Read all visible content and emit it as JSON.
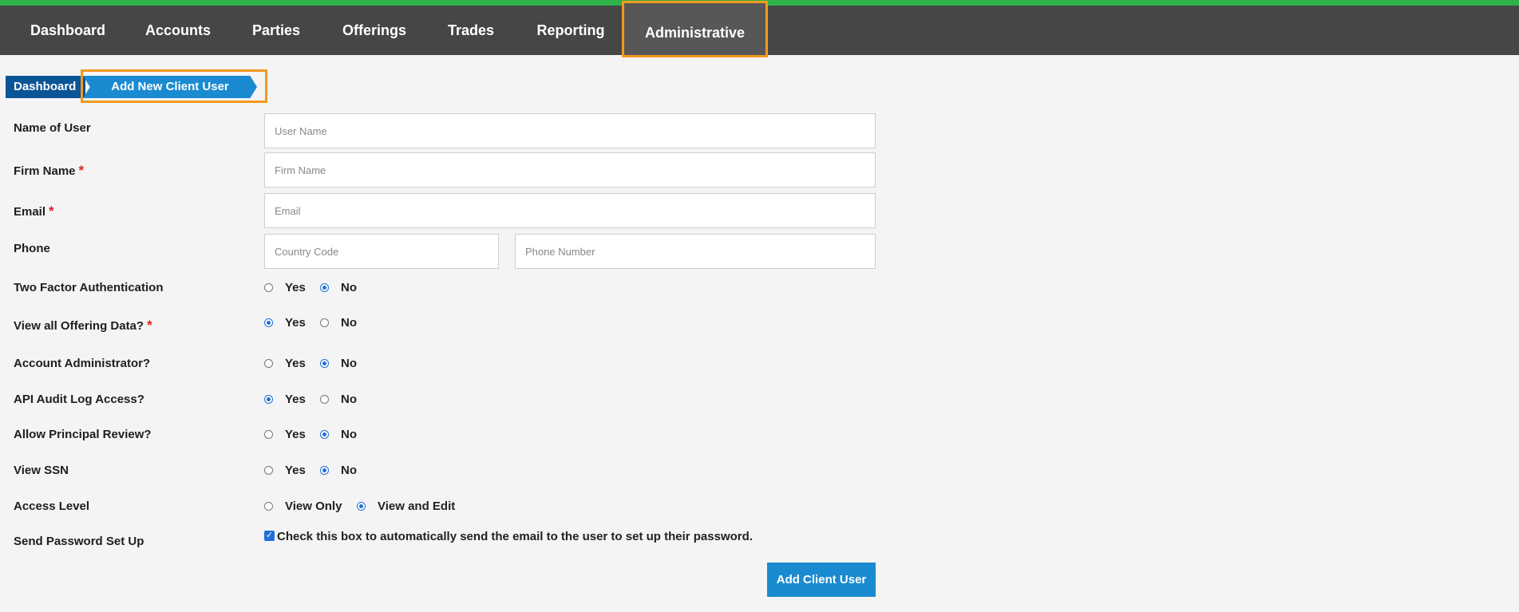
{
  "nav": {
    "items": [
      {
        "label": "Dashboard"
      },
      {
        "label": "Accounts"
      },
      {
        "label": "Parties"
      },
      {
        "label": "Offerings"
      },
      {
        "label": "Trades"
      },
      {
        "label": "Reporting"
      },
      {
        "label": "Administrative",
        "active": true
      }
    ]
  },
  "breadcrumb": {
    "home": "Dashboard",
    "current": "Add New Client User"
  },
  "form": {
    "name_of_user": {
      "label": "Name of User",
      "placeholder": "User Name",
      "value": ""
    },
    "firm_name": {
      "label": "Firm Name",
      "required": "*",
      "placeholder": "Firm Name",
      "value": ""
    },
    "email": {
      "label": "Email",
      "required": "*",
      "placeholder": "Email",
      "value": ""
    },
    "phone": {
      "label": "Phone",
      "country_placeholder": "Country Code",
      "number_placeholder": "Phone Number"
    },
    "two_factor": {
      "label": "Two Factor Authentication",
      "yes": "Yes",
      "no": "No",
      "selected": "No"
    },
    "view_all_offering": {
      "label": "View all Offering Data?",
      "required": "*",
      "yes": "Yes",
      "no": "No",
      "selected": "Yes"
    },
    "account_admin": {
      "label": "Account Administrator?",
      "yes": "Yes",
      "no": "No",
      "selected": "No"
    },
    "api_audit": {
      "label": "API Audit Log Access?",
      "yes": "Yes",
      "no": "No",
      "selected": "Yes"
    },
    "principal_review": {
      "label": "Allow Principal Review?",
      "yes": "Yes",
      "no": "No",
      "selected": "No"
    },
    "view_ssn": {
      "label": "View SSN",
      "yes": "Yes",
      "no": "No",
      "selected": "No"
    },
    "access_level": {
      "label": "Access Level",
      "opt1": "View Only",
      "opt2": "View and Edit",
      "selected": "View and Edit"
    },
    "send_password": {
      "label": "Send Password Set Up",
      "checkbox_text": "Check this box to automatically send the email to the user to set up their password.",
      "checked": true
    },
    "submit_label": "Add Client User"
  },
  "colors": {
    "nav_bg": "#464646",
    "accent_green": "#2db24a",
    "highlight": "#f39a1e",
    "primary_blue": "#1a8bd0",
    "dark_blue": "#0a5596",
    "required_red": "#e02020"
  }
}
